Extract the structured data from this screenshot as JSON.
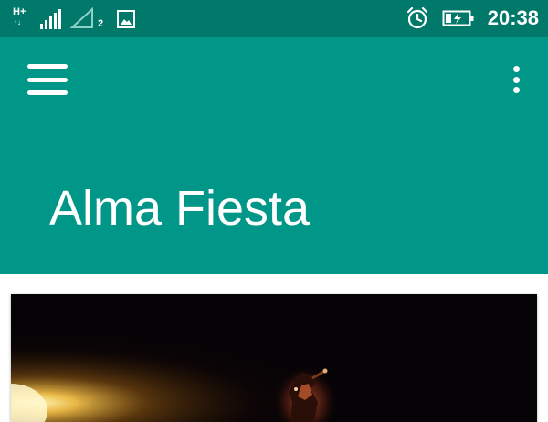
{
  "status_bar": {
    "network_type": "H+",
    "sim2_label": "2",
    "time": "20:38",
    "icons": [
      "network-type-icon",
      "signal-strength-icon",
      "sim2-signal-icon",
      "image-notification-icon",
      "alarm-icon",
      "battery-charging-icon"
    ],
    "colors": {
      "background": "#00796b"
    }
  },
  "app_bar": {
    "title": "Alma Fiesta",
    "menu_icon": "hamburger-menu-icon",
    "overflow_icon": "more-vert-icon",
    "colors": {
      "background": "#009688",
      "text": "#ffffff"
    }
  },
  "content": {
    "image_card": {
      "subject": "performer-on-dark-stage"
    }
  }
}
